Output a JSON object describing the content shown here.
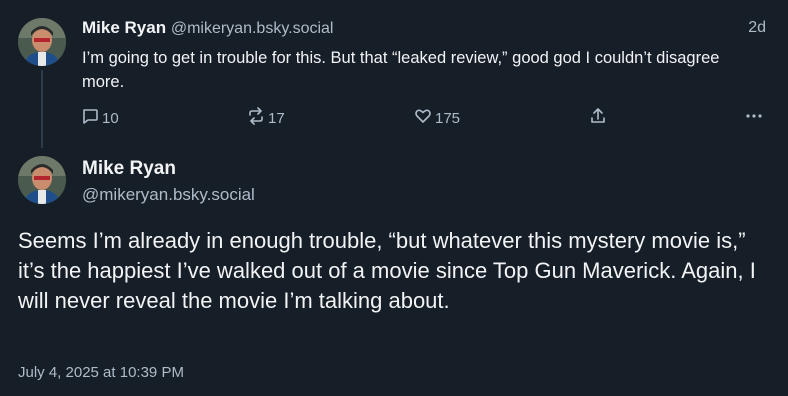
{
  "reply": {
    "author_name": "Mike Ryan",
    "author_handle": "@mikeryan.bsky.social",
    "time_ago": "2d",
    "text": "I’m going to get in trouble for this. But that “leaked review,” good god I couldn’t disagree more.",
    "counts": {
      "replies": "10",
      "reposts": "17",
      "likes": "175"
    },
    "icons": {
      "reply": "comment-icon",
      "repost": "repost-icon",
      "like": "heart-icon",
      "share": "share-icon",
      "more": "more-icon"
    }
  },
  "post": {
    "author_name": "Mike Ryan",
    "author_handle": "@mikeryan.bsky.social",
    "text": "Seems I’m already in enough trouble, “but whatever this mystery movie is,” it’s the happiest I’ve walked out of a movie since Top Gun Maverick. Again, I will never reveal the movie I’m talking about.",
    "timestamp": "July 4, 2025 at 10:39 PM"
  },
  "colors": {
    "background": "#161e27",
    "text_primary": "#f1f3f5",
    "text_secondary": "#aebbc9",
    "thread_line": "#2e3b4a"
  }
}
